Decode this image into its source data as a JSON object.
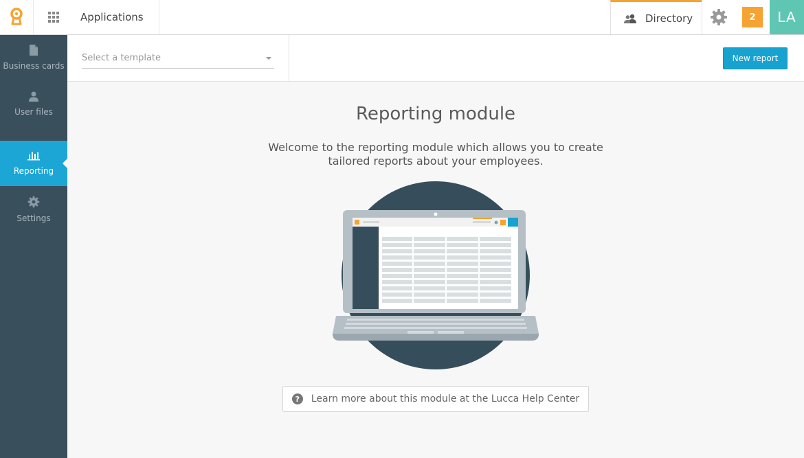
{
  "header": {
    "app_title": "Applications",
    "directory_label": "Directory",
    "notification_count": "2",
    "user_initials": "LA"
  },
  "sidebar": {
    "items": [
      {
        "label": "Business cards",
        "icon": "document-icon"
      },
      {
        "label": "User files",
        "icon": "user-icon"
      },
      {
        "label": "Reporting",
        "icon": "bar-chart-icon",
        "active": true
      },
      {
        "label": "Settings",
        "icon": "gear-icon"
      }
    ]
  },
  "toolbar": {
    "template_placeholder": "Select a template",
    "new_report_label": "New report"
  },
  "main": {
    "title": "Reporting module",
    "description": "Welcome to the reporting module which allows you to create tailored reports about your employees.",
    "help_label": "Learn more about this module at the Lucca Help Center"
  },
  "colors": {
    "accent": "#1ba6d6",
    "orange": "#f7a331",
    "sidebar": "#3a4f5c",
    "avatar": "#5ec6b3"
  }
}
